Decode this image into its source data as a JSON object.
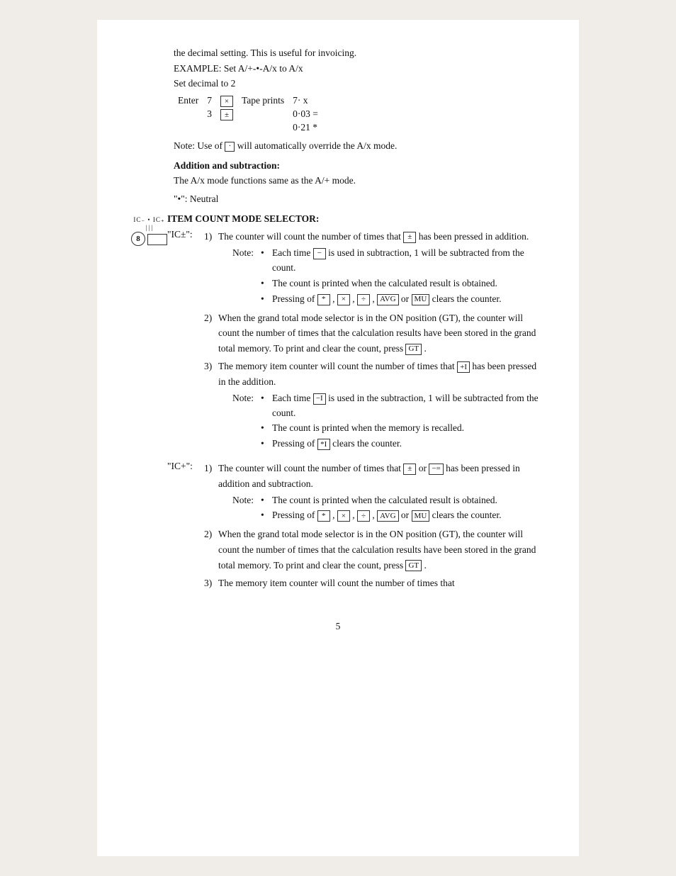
{
  "page": {
    "number": "5"
  },
  "intro": {
    "line1": "the decimal setting.  This is useful for invoicing.",
    "example_label": "EXAMPLE: Set A/+-•-A/x to A/x",
    "set_decimal": "Set decimal to 2",
    "enter_label": "Enter",
    "enter_val1": "7",
    "enter_val2": "3",
    "tape_label": "Tape prints",
    "tape_val1": "7· x",
    "tape_val2": "0·03 =",
    "tape_val3": "0·21 *",
    "note_text": "Note:  Use of",
    "note_key": "·",
    "note_rest": "will automatically override the A/x mode."
  },
  "addition_subtraction": {
    "heading": "Addition and subtraction:",
    "text": "The A/x mode functions same as the A/+ mode."
  },
  "neutral": {
    "label": "\"•\": Neutral"
  },
  "item_count": {
    "circle_num": "8",
    "selector_ticks": "IC₋  •  IC₊",
    "title": "ITEM COUNT MODE SELECTOR:",
    "ic_plus_minus_label": "\"IC±\":",
    "ic_plus_minus_items": [
      {
        "num": "1)",
        "text": "The counter will count the number of times that",
        "key_inline": "±",
        "text2": "has been pressed in addition.",
        "note_label": "Note:",
        "bullets": [
          {
            "text": "Each time",
            "key": "−",
            "text2": "is used in subtraction, 1 will be subtracted from the count."
          },
          {
            "text": "The count is printed when the calculated result is obtained."
          },
          {
            "text": "Pressing of",
            "keys": [
              "*",
              "×",
              "÷",
              "AVG",
              "MU"
            ],
            "text2": "clears the counter."
          }
        ]
      },
      {
        "num": "2)",
        "text": "When the grand total mode selector is in the ON position (GT), the counter will count the number of times that the calculation results have been stored in the grand total memory.  To print and clear the count, press",
        "key_inline": "GT",
        "text2": "."
      },
      {
        "num": "3)",
        "text": "The memory item counter will count the number of times that",
        "key_inline": "+I",
        "text2": "has been pressed in the addition.",
        "note_label": "Note:",
        "bullets": [
          {
            "text": "Each time",
            "key": "−I",
            "text2": "is used in the subtraction, 1 will be subtracted from the count."
          },
          {
            "text": "The count is printed when the memory is recalled."
          },
          {
            "text": "Pressing of",
            "key": "*I",
            "text2": "clears the counter."
          }
        ]
      }
    ],
    "ic_plus_label": "\"IC+\":",
    "ic_plus_items": [
      {
        "num": "1)",
        "text": "The counter will count the number of times that",
        "key1": "±",
        "text_or": "or",
        "key2": "−=",
        "text2": "has been pressed in addition and subtraction.",
        "note_label": "Note:",
        "bullets": [
          {
            "text": "The count is printed when the calculated result is obtained."
          },
          {
            "text": "Pressing of",
            "keys": [
              "*",
              "×",
              "÷",
              "AVG",
              "MU"
            ],
            "text2": "clears the counter."
          }
        ]
      },
      {
        "num": "2)",
        "text": "When the grand total mode selector is in the ON position (GT), the counter will count the number of times that the calculation results have been stored in the grand total memory.  To print and clear the count, press",
        "key_inline": "GT",
        "text2": "."
      },
      {
        "num": "3)",
        "text": "The memory item counter will count the number of times that"
      }
    ]
  }
}
